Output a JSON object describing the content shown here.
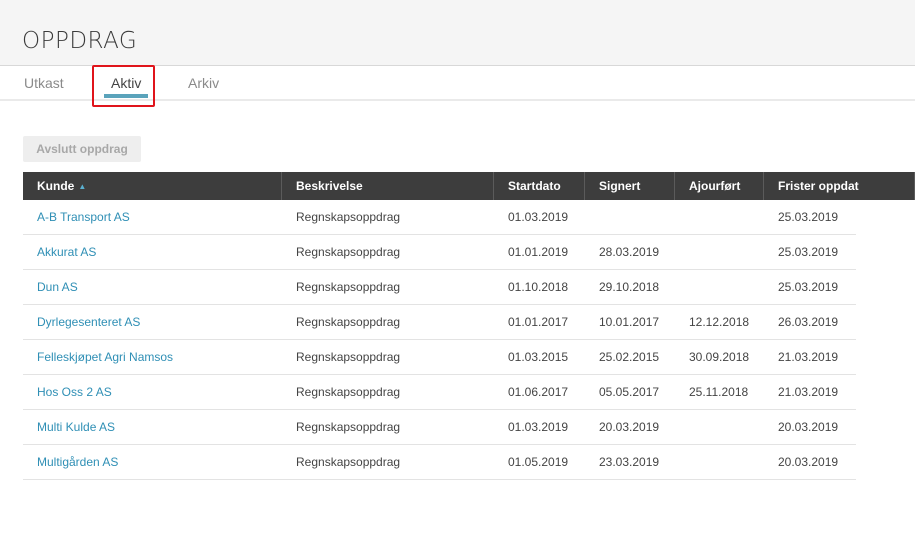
{
  "header": {
    "title": "OPPDRAG"
  },
  "tabs": [
    {
      "label": "Utkast"
    },
    {
      "label": "Aktiv"
    },
    {
      "label": "Arkiv"
    }
  ],
  "toolbar": {
    "avslutt_label": "Avslutt oppdrag"
  },
  "table": {
    "columns": [
      "Kunde",
      "Beskrivelse",
      "Startdato",
      "Signert",
      "Ajourført",
      "Frister oppdat"
    ],
    "rows": [
      [
        "A-B Transport AS",
        "Regnskapsoppdrag",
        "01.03.2019",
        "",
        "",
        "25.03.2019"
      ],
      [
        "Akkurat AS",
        "Regnskapsoppdrag",
        "01.01.2019",
        "28.03.2019",
        "",
        "25.03.2019"
      ],
      [
        "Dun AS",
        "Regnskapsoppdrag",
        "01.10.2018",
        "29.10.2018",
        "",
        "25.03.2019"
      ],
      [
        "Dyrlegesenteret AS",
        "Regnskapsoppdrag",
        "01.01.2017",
        "10.01.2017",
        "12.12.2018",
        "26.03.2019"
      ],
      [
        "Felleskjøpet Agri Namsos",
        "Regnskapsoppdrag",
        "01.03.2015",
        "25.02.2015",
        "30.09.2018",
        "21.03.2019"
      ],
      [
        "Hos Oss 2 AS",
        "Regnskapsoppdrag",
        "01.06.2017",
        "05.05.2017",
        "25.11.2018",
        "21.03.2019"
      ],
      [
        "Multi Kulde AS",
        "Regnskapsoppdrag",
        "01.03.2019",
        "20.03.2019",
        "",
        "20.03.2019"
      ],
      [
        "Multigården AS",
        "Regnskapsoppdrag",
        "01.05.2019",
        "23.03.2019",
        "",
        "20.03.2019"
      ]
    ]
  },
  "colors": {
    "accent": "#5aa3bb",
    "link": "#2f8fb5",
    "header_bg": "#3d3d3d",
    "highlight": "#e0141b"
  }
}
